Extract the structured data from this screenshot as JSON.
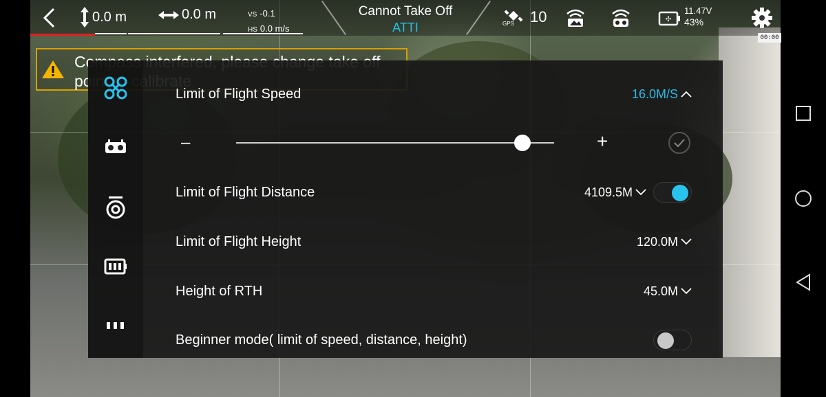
{
  "topbar": {
    "altitude": "0.0 m",
    "distance": "0.0 m",
    "vs_label": "VS",
    "vs_value": "-0.1",
    "hs_label": "HS",
    "hs_value": "0.0 m/s",
    "status": "Cannot Take Off",
    "mode": "ATTI",
    "gps_label": "GPS",
    "satellites": "10",
    "voltage": "11.47V",
    "battery_percent": "43%",
    "timer": "00:00"
  },
  "warning": {
    "text": "Compass interfered, please change take off point or calibrate"
  },
  "settings": {
    "rows": [
      {
        "label": "Limit of Flight Speed",
        "value": "16.0M/S"
      },
      {
        "label": "Limit of Flight Distance",
        "value": "4109.5M"
      },
      {
        "label": "Limit of Flight Height",
        "value": "120.0M"
      },
      {
        "label": "Height of RTH",
        "value": "45.0M"
      },
      {
        "label": "Beginner mode( limit of speed, distance, height)",
        "value": ""
      }
    ],
    "slider": {
      "minus": "–",
      "plus": "+",
      "level": 0.9
    },
    "distance_limit_enabled": true,
    "beginner_mode_enabled": false
  },
  "colors": {
    "accent": "#2db8e6",
    "warning": "#d9a000",
    "alert_line": "#e02020"
  },
  "icons": {
    "sidebar": [
      "drone-icon",
      "remote-controller-icon",
      "camera-gimbal-icon",
      "battery-icon",
      "more-icon"
    ]
  }
}
